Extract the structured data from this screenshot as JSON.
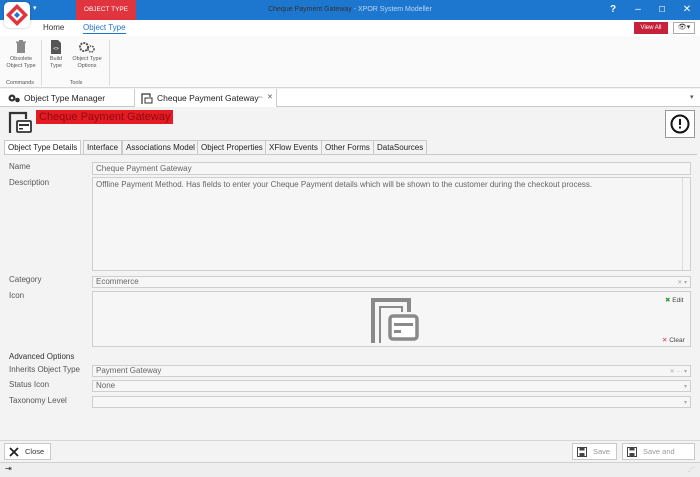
{
  "window": {
    "context_tab": "OBJECT TYPE",
    "title": "Cheque Payment Gateway",
    "subtitle": " - XPOR System Modeller",
    "help_label": "?"
  },
  "ribbon": {
    "tabs": [
      {
        "label": "Home"
      },
      {
        "label": "Object Type"
      }
    ],
    "view_all": "View All",
    "groups": [
      {
        "label": "Commands",
        "buttons": [
          {
            "label": "Obsolete Object Type"
          }
        ]
      },
      {
        "label": "Tools",
        "buttons": [
          {
            "label": "Build Type"
          },
          {
            "label": "Object Type Options"
          }
        ]
      }
    ]
  },
  "doc_tabs": [
    {
      "label": "Object Type Manager"
    },
    {
      "label": "Cheque Payment Gateway"
    }
  ],
  "header": {
    "title": "Cheque Payment Gateway",
    "help_icon": "exclamation-circle-icon"
  },
  "inner_tabs": [
    {
      "label": "Object Type Details"
    },
    {
      "label": "Interface"
    },
    {
      "label": "Associations Model"
    },
    {
      "label": "Object Properties"
    },
    {
      "label": "XFlow Events"
    },
    {
      "label": "Other Forms"
    },
    {
      "label": "DataSources"
    }
  ],
  "form": {
    "name": {
      "label": "Name",
      "value": "Cheque Payment Gateway"
    },
    "description": {
      "label": "Description",
      "value": "Offline Payment Method. Has fields to enter your Cheque Payment details which will be shown to the customer during the checkout process."
    },
    "category": {
      "label": "Category",
      "value": "Ecommerce"
    },
    "icon": {
      "label": "Icon",
      "edit": "Edit",
      "clear": "Clear"
    },
    "advanced_title": "Advanced Options",
    "inherits": {
      "label": "Inherits Object Type",
      "value": "Payment Gateway"
    },
    "status_icon": {
      "label": "Status Icon",
      "value": "None"
    },
    "taxonomy": {
      "label": "Taxonomy Level",
      "value": ""
    }
  },
  "footer": {
    "close": "Close",
    "save": "Save",
    "save_close": "Save and Close"
  },
  "colors": {
    "titlebar": "#1e77cf",
    "accent_red": "#e51b24",
    "view_all": "#c8213b"
  }
}
